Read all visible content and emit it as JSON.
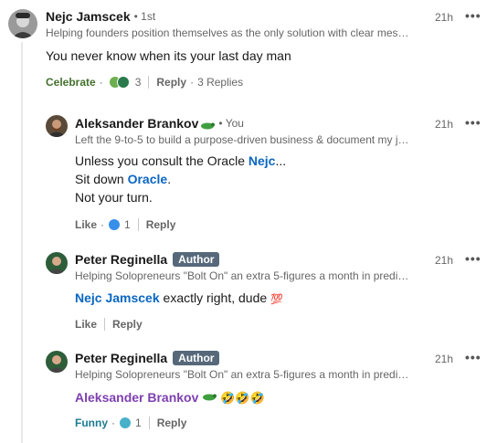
{
  "comments": [
    {
      "author": "Nejc Jamscek",
      "degree": "• 1st",
      "headline": "Helping founders position themselves as the only solution with clear mes…",
      "time": "21h",
      "text": "You never know when its your last day man",
      "reaction_label": "Celebrate",
      "reaction_count": "3",
      "reply_label": "Reply",
      "replies_text": "3 Replies"
    },
    {
      "author": "Aleksander Brankov",
      "degree": "• You",
      "headline": "Left the 9-to-5 to build a purpose-driven business & document my j…",
      "time": "21h",
      "line1_prefix": "Unless you consult the Oracle ",
      "line1_mention": "Nejc",
      "line1_suffix": "...",
      "line2_prefix": "Sit down ",
      "line2_mention": "Oracle",
      "line2_suffix": ".",
      "line3": "Not your turn.",
      "reaction_label": "Like",
      "reaction_count": "1",
      "reply_label": "Reply"
    },
    {
      "author": "Peter Reginella",
      "badge": "Author",
      "headline": "Helping Solopreneurs \"Bolt On\" an extra 5-figures a month in predi…",
      "time": "21h",
      "mention": "Nejc Jamscek",
      "text": " exactly right, dude ",
      "emoji": "💯",
      "reaction_label": "Like",
      "reply_label": "Reply"
    },
    {
      "author": "Peter Reginella",
      "badge": "Author",
      "headline": "Helping Solopreneurs \"Bolt On\" an extra 5-figures a month in predi…",
      "time": "21h",
      "mention": "Aleksander Brankov",
      "emoji": "🤣🤣🤣",
      "reaction_label": "Funny",
      "reaction_count": "1",
      "reply_label": "Reply"
    }
  ],
  "more_glyph": "•••",
  "colors": {
    "link_blue": "#0a66c2",
    "mention_purple": "#7e3fb0",
    "celebrate_green": "#44712e",
    "funny_teal": "#1c7c90",
    "badge_bg": "#56687a"
  },
  "icons": [
    "avatar",
    "dragon-emoji-icon",
    "celebrate-reaction-icon",
    "support-reaction-icon",
    "like-reaction-icon",
    "funny-reaction-icon",
    "more-options-icon"
  ]
}
